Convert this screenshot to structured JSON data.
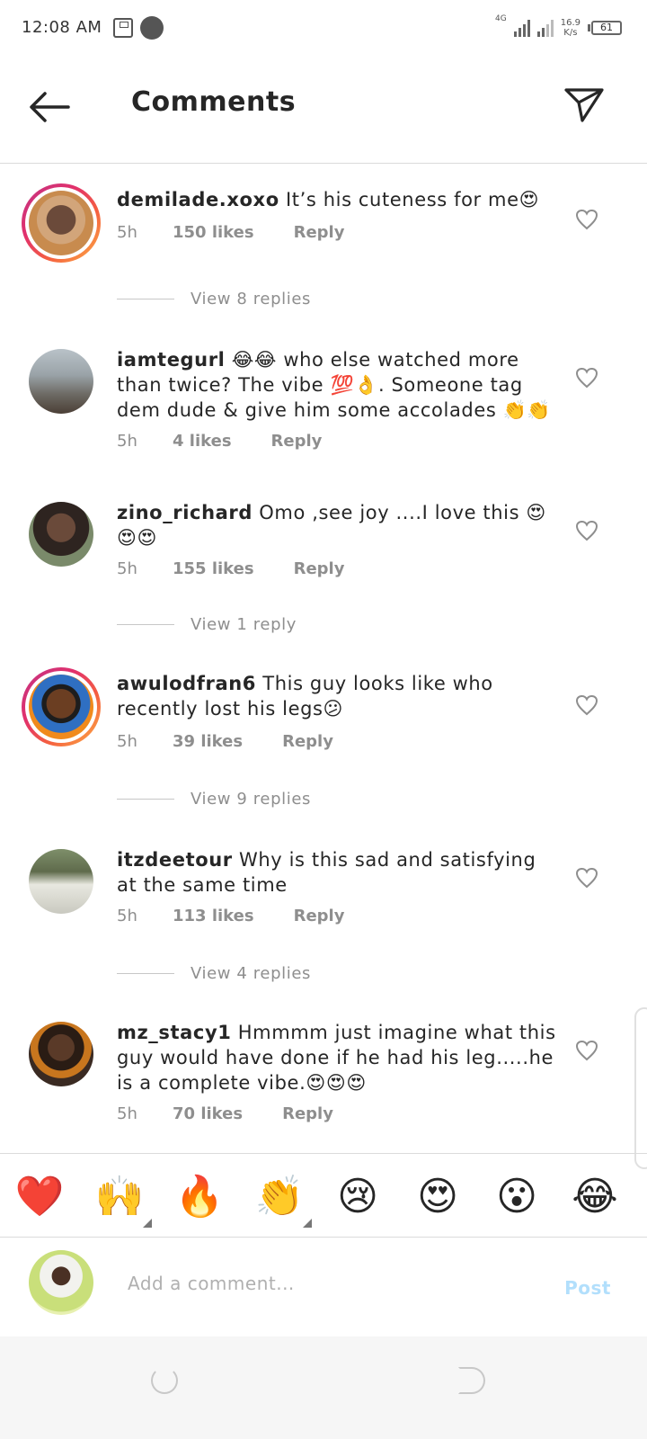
{
  "status_bar": {
    "time": "12:08 AM",
    "network": "4G",
    "speed_value": "16.9",
    "speed_unit": "K/s",
    "battery": "61"
  },
  "header": {
    "title": "Comments",
    "back_icon": "arrow-left-icon",
    "send_icon": "paper-plane-icon"
  },
  "comments": [
    {
      "username": "demilade.xoxo",
      "text": "It’s his cuteness for me😍",
      "time": "5h",
      "likes": "150 likes",
      "reply": "Reply",
      "view_replies": "View 8 replies"
    },
    {
      "username": "iamtegurl",
      "text": "😂😂 who else watched more than twice? The vibe 💯👌. Someone tag dem dude & give him some accolades 👏👏",
      "time": "5h",
      "likes": "4 likes",
      "reply": "Reply"
    },
    {
      "username": "zino_richard",
      "text": "Omo ,see joy ....I love this 😍😍😍",
      "time": "5h",
      "likes": "155 likes",
      "reply": "Reply",
      "view_replies": "View 1 reply"
    },
    {
      "username": "awulodfran6",
      "text": "This guy looks like who recently lost his legs😕",
      "time": "5h",
      "likes": "39 likes",
      "reply": "Reply",
      "view_replies": "View 9 replies"
    },
    {
      "username": "itzdeetour",
      "text": "Why is this sad and satisfying at the same time",
      "time": "5h",
      "likes": "113 likes",
      "reply": "Reply",
      "view_replies": "View 4 replies"
    },
    {
      "username": "mz_stacy1",
      "text": "Hmmmm just imagine what this guy would have done if he had his leg.....he is a complete vibe.😍😍😍",
      "time": "5h",
      "likes": "70 likes",
      "reply": "Reply"
    }
  ],
  "emoji_bar": [
    "❤️",
    "🙌",
    "🔥",
    "👏",
    "😢",
    "😍",
    "😮",
    "😂"
  ],
  "input": {
    "placeholder": "Add a comment...",
    "post_label": "Post"
  },
  "colors": {
    "accent_post_disabled": "#b2dffc",
    "meta_gray": "#8e8e8e",
    "text": "#262626",
    "story_ring_start": "#c13584",
    "story_ring_end": "#fcaf45"
  }
}
